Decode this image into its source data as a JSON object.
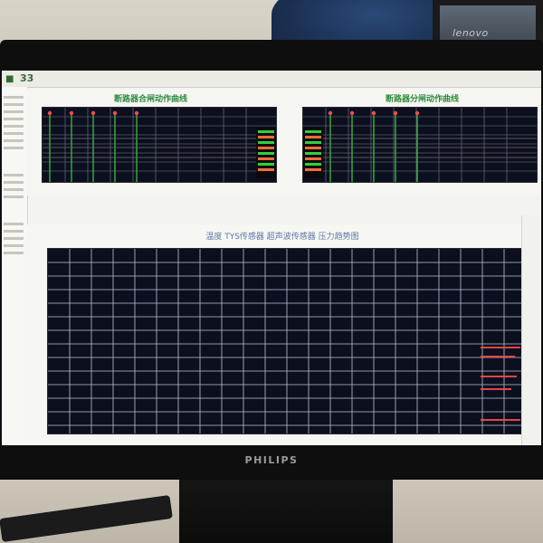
{
  "environment": {
    "background_monitor_logo": "lenovo",
    "monitor_brand": "PHILIPS"
  },
  "app": {
    "title_label": "33",
    "top_left_chart_title": "断路器合闸动作曲线",
    "top_right_chart_title": "断路器分闸动作曲线",
    "main_chart_title": "温度  TYS传感器  超声波传感器  压力趋势图"
  },
  "colors": {
    "chart_background": "#0c0f1e",
    "grid_color": "#d0d6ea",
    "green_markers": "#3fcf3f",
    "red_markers": "#ff4a4a",
    "title_green": "#2f8a3d",
    "title_blue": "#5f78a6"
  }
}
